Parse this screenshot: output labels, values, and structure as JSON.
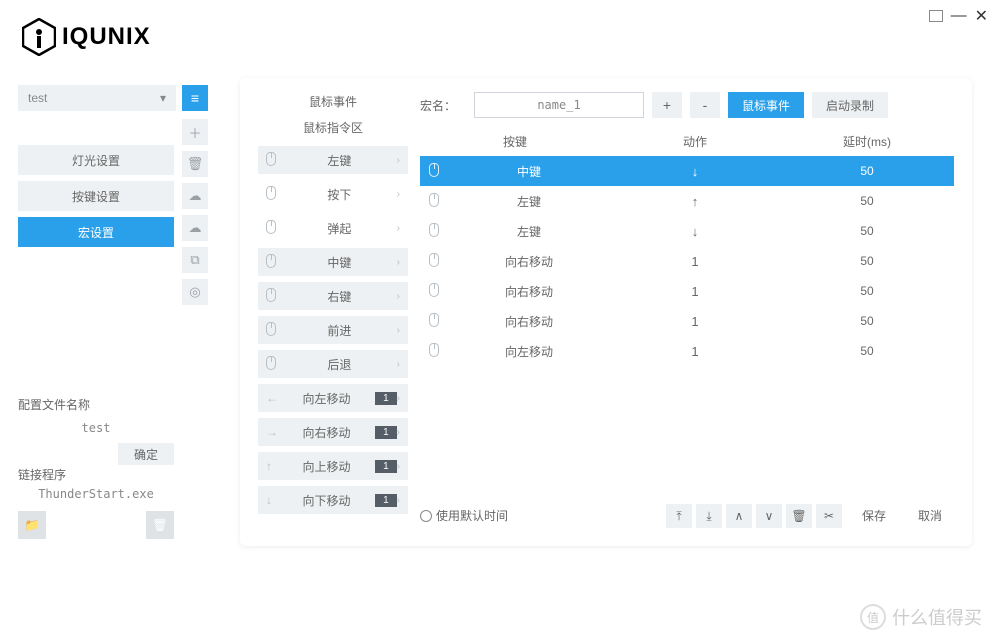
{
  "brand": "IQUNIX",
  "window": {
    "maximize": "▢",
    "minimize": "—",
    "close": "✕"
  },
  "profile": {
    "name": "test",
    "menu_icon": "≡"
  },
  "tools": [
    "＋",
    "🗑",
    "☁",
    "☁",
    "⧉",
    "◎"
  ],
  "nav": [
    {
      "label": "灯光设置",
      "active": false
    },
    {
      "label": "按键设置",
      "active": false
    },
    {
      "label": "宏设置",
      "active": true
    }
  ],
  "config": {
    "label": "配置文件名称",
    "value": "test",
    "confirm": "确定"
  },
  "link": {
    "label": "链接程序",
    "path": "ThunderStart.exe"
  },
  "cmd": {
    "title": "鼠标事件",
    "subtitle": "鼠标指令区",
    "items": [
      {
        "icon": "mouse",
        "label": "左键",
        "chev": true
      },
      {
        "icon": "mouse",
        "label": "按下",
        "chev": true,
        "indent": true
      },
      {
        "icon": "mouse",
        "label": "弹起",
        "chev": true,
        "indent": true
      },
      {
        "icon": "mouse",
        "label": "中键",
        "chev": true
      },
      {
        "icon": "mouse",
        "label": "右键",
        "chev": true
      },
      {
        "icon": "mouse",
        "label": "前进",
        "chev": true
      },
      {
        "icon": "mouse",
        "label": "后退",
        "chev": true
      },
      {
        "icon": "←",
        "label": "向左移动",
        "badge": "1",
        "chev": true
      },
      {
        "icon": "→",
        "label": "向右移动",
        "badge": "1",
        "chev": true
      },
      {
        "icon": "↑",
        "label": "向上移动",
        "badge": "1",
        "chev": true
      },
      {
        "icon": "↓",
        "label": "向下移动",
        "badge": "1",
        "chev": true
      }
    ]
  },
  "macro": {
    "name_label": "宏名：",
    "name_value": "name_1",
    "plus": "+",
    "minus": "-",
    "event_btn": "鼠标事件",
    "record_btn": "启动录制",
    "headers": {
      "key": "按键",
      "action": "动作",
      "delay": "延时(ms)"
    },
    "rows": [
      {
        "key": "中键",
        "action": "↓",
        "delay": "50",
        "sel": true
      },
      {
        "key": "左键",
        "action": "↑",
        "delay": "50"
      },
      {
        "key": "左键",
        "action": "↓",
        "delay": "50"
      },
      {
        "key": "向右移动",
        "action": "1",
        "delay": "50"
      },
      {
        "key": "向右移动",
        "action": "1",
        "delay": "50"
      },
      {
        "key": "向右移动",
        "action": "1",
        "delay": "50"
      },
      {
        "key": "向左移动",
        "action": "1",
        "delay": "50"
      }
    ],
    "default_time": "使用默认时间",
    "mini": [
      "⤒",
      "⤓",
      "∧",
      "∨",
      "🗑",
      "✂"
    ],
    "save": "保存",
    "cancel": "取消"
  },
  "watermark": {
    "char": "值",
    "text": "什么值得买"
  }
}
